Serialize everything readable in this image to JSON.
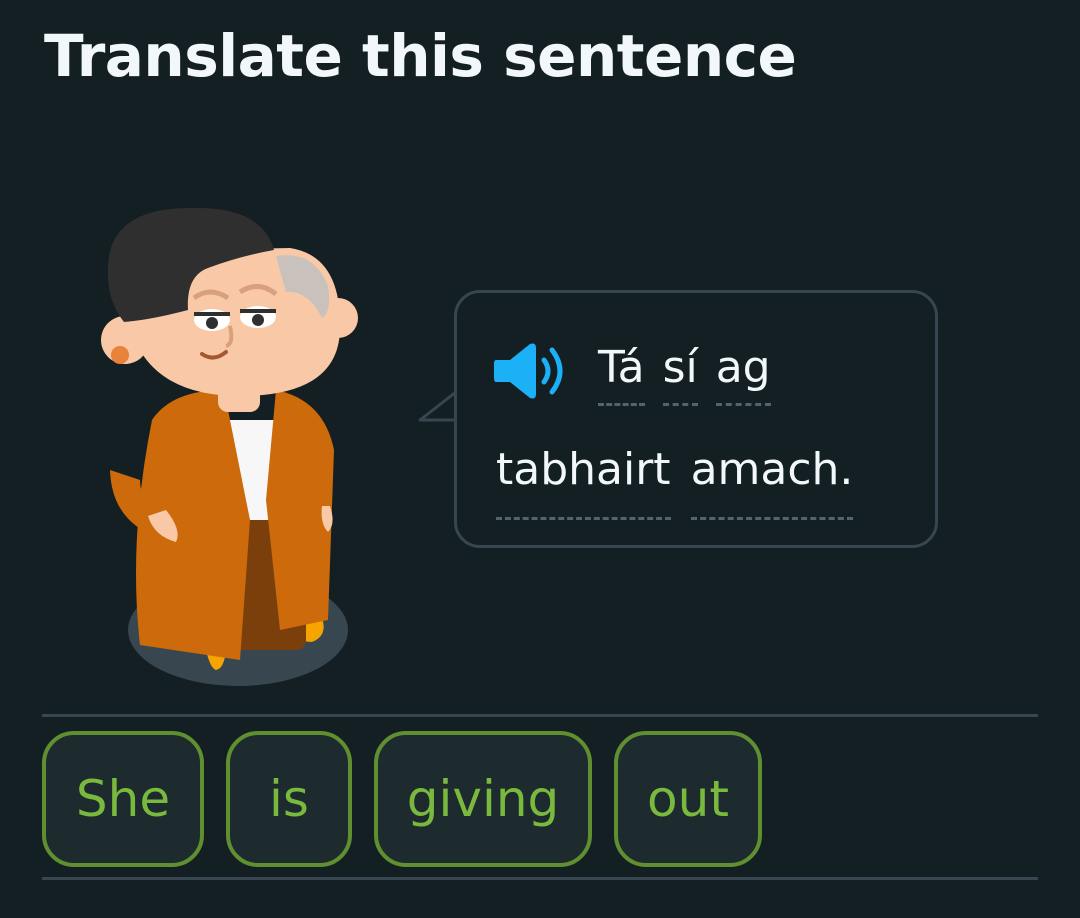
{
  "header": {
    "title": "Translate this sentence"
  },
  "prompt": {
    "speaker_icon": "speaker-icon",
    "line1": [
      "Tá",
      "sí",
      "ag"
    ],
    "line2": [
      "tabhairt",
      "amach."
    ]
  },
  "word_bank": [
    "She",
    "is",
    "giving",
    "out"
  ],
  "colors": {
    "background": "#141f23",
    "bubble_border": "#37464f",
    "chip_border": "#5f8f2f",
    "chip_text": "#79b93d",
    "speaker": "#1cb0f6"
  }
}
